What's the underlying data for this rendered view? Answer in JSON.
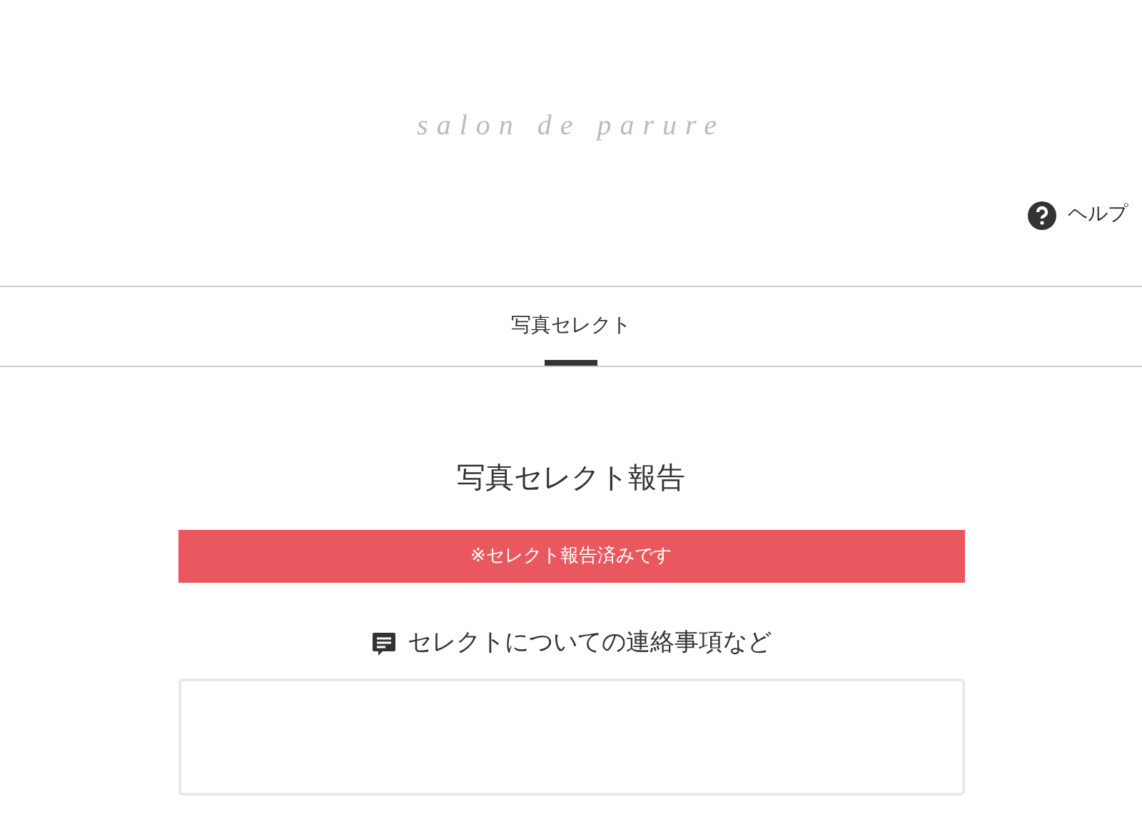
{
  "header": {
    "logo": "salon de parure",
    "help": "ヘルプ"
  },
  "tabs": [
    {
      "label": "写真セレクト",
      "selected": true
    }
  ],
  "title": "写真セレクト報告",
  "notice": "※セレクト報告済みです",
  "message": {
    "label": "セレクトについての連絡事項など"
  }
}
